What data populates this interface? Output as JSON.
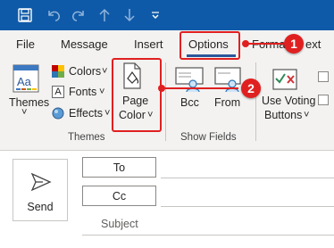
{
  "quick_access": {
    "icons": [
      "save-icon",
      "undo-icon",
      "redo-icon",
      "up-icon",
      "down-icon",
      "customize-icon"
    ]
  },
  "tabs": {
    "file": "File",
    "message": "Message",
    "insert": "Insert",
    "options": "Options",
    "format_text_partial": "Forma",
    "format_text_tail": "ext"
  },
  "ribbon": {
    "themes": {
      "label": "Themes",
      "chevron": "˅"
    },
    "colors": {
      "label": "Colors",
      "chevron": "˅"
    },
    "fonts": {
      "label": "Fonts",
      "chevron": "˅"
    },
    "effects": {
      "label": "Effects",
      "chevron": "˅"
    },
    "page_color": {
      "line1": "Page",
      "line2": "Color",
      "chevron": "˅"
    },
    "bcc": {
      "label": "Bcc"
    },
    "from": {
      "label": "From"
    },
    "voting": {
      "line1": "Use Voting",
      "line2": "Buttons",
      "chevron": "˅"
    },
    "groups": {
      "themes": "Themes",
      "show_fields": "Show Fields"
    }
  },
  "annotations": {
    "badge1": "1",
    "badge2": "2"
  },
  "compose": {
    "send": "Send",
    "to": "To",
    "cc": "Cc",
    "subject": "Subject"
  },
  "colors": {
    "title_bar": "#0f5aa8",
    "accent_underline": "#2b579a",
    "annotation_red": "#e02020"
  }
}
